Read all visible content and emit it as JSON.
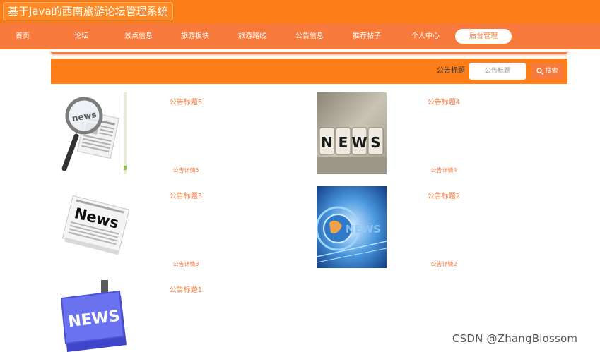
{
  "header": {
    "site_title": "基于Java的西南旅游论坛管理系统"
  },
  "nav": {
    "items": [
      {
        "label": "首页"
      },
      {
        "label": "论坛"
      },
      {
        "label": "景点信息"
      },
      {
        "label": "旅游板块"
      },
      {
        "label": "旅游路线"
      },
      {
        "label": "公告信息"
      },
      {
        "label": "推荐帖子"
      },
      {
        "label": "个人中心"
      },
      {
        "label": "后台管理"
      }
    ],
    "active_index": 8
  },
  "search": {
    "label": "公告标题",
    "placeholder": "公告标题",
    "button_label": "搜索"
  },
  "notices": [
    {
      "title": "公告标题5",
      "detail": "公告详情5",
      "image": "magnifier-newspaper"
    },
    {
      "title": "公告标题4",
      "detail": "公告详情4",
      "image": "news-cubes"
    },
    {
      "title": "公告标题3",
      "detail": "公告详情3",
      "image": "news-paper"
    },
    {
      "title": "公告标题2",
      "detail": "公告详情2",
      "image": "news-blue-globe"
    },
    {
      "title": "公告标题1",
      "detail": "",
      "image": "news-key"
    }
  ],
  "watermark": "CSDN @ZhangBlossom",
  "colors": {
    "header": "#fe7f1a",
    "nav": "#f87a3c",
    "accent_text": "#f87a3c"
  }
}
